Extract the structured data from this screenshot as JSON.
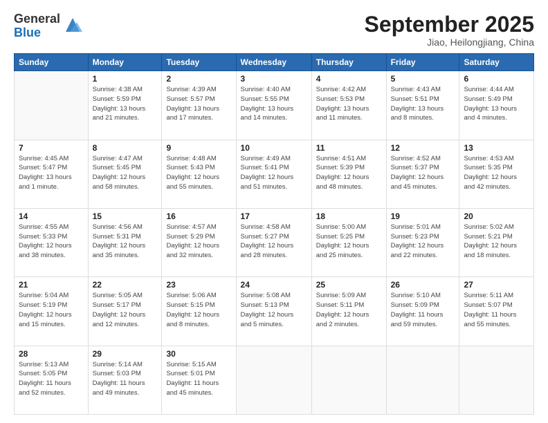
{
  "logo": {
    "general": "General",
    "blue": "Blue"
  },
  "header": {
    "month": "September 2025",
    "location": "Jiao, Heilongjiang, China"
  },
  "weekdays": [
    "Sunday",
    "Monday",
    "Tuesday",
    "Wednesday",
    "Thursday",
    "Friday",
    "Saturday"
  ],
  "weeks": [
    [
      {
        "day": "",
        "info": ""
      },
      {
        "day": "1",
        "info": "Sunrise: 4:38 AM\nSunset: 5:59 PM\nDaylight: 13 hours\nand 21 minutes."
      },
      {
        "day": "2",
        "info": "Sunrise: 4:39 AM\nSunset: 5:57 PM\nDaylight: 13 hours\nand 17 minutes."
      },
      {
        "day": "3",
        "info": "Sunrise: 4:40 AM\nSunset: 5:55 PM\nDaylight: 13 hours\nand 14 minutes."
      },
      {
        "day": "4",
        "info": "Sunrise: 4:42 AM\nSunset: 5:53 PM\nDaylight: 13 hours\nand 11 minutes."
      },
      {
        "day": "5",
        "info": "Sunrise: 4:43 AM\nSunset: 5:51 PM\nDaylight: 13 hours\nand 8 minutes."
      },
      {
        "day": "6",
        "info": "Sunrise: 4:44 AM\nSunset: 5:49 PM\nDaylight: 13 hours\nand 4 minutes."
      }
    ],
    [
      {
        "day": "7",
        "info": "Sunrise: 4:45 AM\nSunset: 5:47 PM\nDaylight: 13 hours\nand 1 minute."
      },
      {
        "day": "8",
        "info": "Sunrise: 4:47 AM\nSunset: 5:45 PM\nDaylight: 12 hours\nand 58 minutes."
      },
      {
        "day": "9",
        "info": "Sunrise: 4:48 AM\nSunset: 5:43 PM\nDaylight: 12 hours\nand 55 minutes."
      },
      {
        "day": "10",
        "info": "Sunrise: 4:49 AM\nSunset: 5:41 PM\nDaylight: 12 hours\nand 51 minutes."
      },
      {
        "day": "11",
        "info": "Sunrise: 4:51 AM\nSunset: 5:39 PM\nDaylight: 12 hours\nand 48 minutes."
      },
      {
        "day": "12",
        "info": "Sunrise: 4:52 AM\nSunset: 5:37 PM\nDaylight: 12 hours\nand 45 minutes."
      },
      {
        "day": "13",
        "info": "Sunrise: 4:53 AM\nSunset: 5:35 PM\nDaylight: 12 hours\nand 42 minutes."
      }
    ],
    [
      {
        "day": "14",
        "info": "Sunrise: 4:55 AM\nSunset: 5:33 PM\nDaylight: 12 hours\nand 38 minutes."
      },
      {
        "day": "15",
        "info": "Sunrise: 4:56 AM\nSunset: 5:31 PM\nDaylight: 12 hours\nand 35 minutes."
      },
      {
        "day": "16",
        "info": "Sunrise: 4:57 AM\nSunset: 5:29 PM\nDaylight: 12 hours\nand 32 minutes."
      },
      {
        "day": "17",
        "info": "Sunrise: 4:58 AM\nSunset: 5:27 PM\nDaylight: 12 hours\nand 28 minutes."
      },
      {
        "day": "18",
        "info": "Sunrise: 5:00 AM\nSunset: 5:25 PM\nDaylight: 12 hours\nand 25 minutes."
      },
      {
        "day": "19",
        "info": "Sunrise: 5:01 AM\nSunset: 5:23 PM\nDaylight: 12 hours\nand 22 minutes."
      },
      {
        "day": "20",
        "info": "Sunrise: 5:02 AM\nSunset: 5:21 PM\nDaylight: 12 hours\nand 18 minutes."
      }
    ],
    [
      {
        "day": "21",
        "info": "Sunrise: 5:04 AM\nSunset: 5:19 PM\nDaylight: 12 hours\nand 15 minutes."
      },
      {
        "day": "22",
        "info": "Sunrise: 5:05 AM\nSunset: 5:17 PM\nDaylight: 12 hours\nand 12 minutes."
      },
      {
        "day": "23",
        "info": "Sunrise: 5:06 AM\nSunset: 5:15 PM\nDaylight: 12 hours\nand 8 minutes."
      },
      {
        "day": "24",
        "info": "Sunrise: 5:08 AM\nSunset: 5:13 PM\nDaylight: 12 hours\nand 5 minutes."
      },
      {
        "day": "25",
        "info": "Sunrise: 5:09 AM\nSunset: 5:11 PM\nDaylight: 12 hours\nand 2 minutes."
      },
      {
        "day": "26",
        "info": "Sunrise: 5:10 AM\nSunset: 5:09 PM\nDaylight: 11 hours\nand 59 minutes."
      },
      {
        "day": "27",
        "info": "Sunrise: 5:11 AM\nSunset: 5:07 PM\nDaylight: 11 hours\nand 55 minutes."
      }
    ],
    [
      {
        "day": "28",
        "info": "Sunrise: 5:13 AM\nSunset: 5:05 PM\nDaylight: 11 hours\nand 52 minutes."
      },
      {
        "day": "29",
        "info": "Sunrise: 5:14 AM\nSunset: 5:03 PM\nDaylight: 11 hours\nand 49 minutes."
      },
      {
        "day": "30",
        "info": "Sunrise: 5:15 AM\nSunset: 5:01 PM\nDaylight: 11 hours\nand 45 minutes."
      },
      {
        "day": "",
        "info": ""
      },
      {
        "day": "",
        "info": ""
      },
      {
        "day": "",
        "info": ""
      },
      {
        "day": "",
        "info": ""
      }
    ]
  ]
}
